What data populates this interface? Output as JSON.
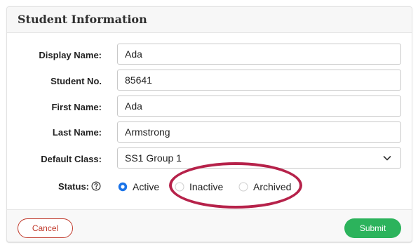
{
  "header": {
    "title": "Student Information"
  },
  "form": {
    "display_name": {
      "label": "Display Name:",
      "value": "Ada"
    },
    "student_no": {
      "label": "Student No.",
      "value": "85641"
    },
    "first_name": {
      "label": "First Name:",
      "value": "Ada"
    },
    "last_name": {
      "label": "Last Name:",
      "value": "Armstrong"
    },
    "default_class": {
      "label": "Default Class:",
      "value": "SS1 Group 1",
      "icon": "chevron-down-icon"
    },
    "status": {
      "label": "Status:",
      "help_icon": "question-circle-icon",
      "selected": "Active",
      "options": [
        {
          "label": "Active",
          "checked": true
        },
        {
          "label": "Inactive",
          "checked": false
        },
        {
          "label": "Archived",
          "checked": false
        }
      ]
    }
  },
  "footer": {
    "cancel_label": "Cancel",
    "submit_label": "Submit"
  },
  "colors": {
    "accent_blue": "#1a73e8",
    "submit_green": "#2cb35c",
    "cancel_red": "#c0392b",
    "highlight_ring": "#b6224a"
  }
}
